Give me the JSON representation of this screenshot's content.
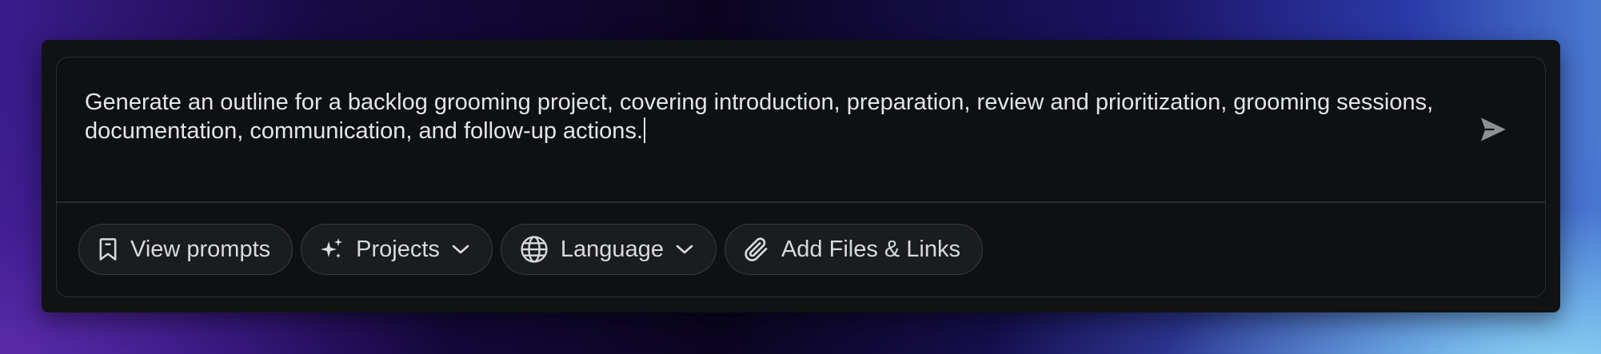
{
  "composer": {
    "prompt_text": "Generate an outline for a backlog grooming project, covering introduction, preparation, review and prioritization, grooming sessions, documentation, communication, and follow-up actions.",
    "send_icon": "send-icon"
  },
  "toolbar": {
    "view_prompts": {
      "label": "View prompts",
      "icon": "bookmark-icon"
    },
    "projects": {
      "label": "Projects",
      "icon": "sparkles-icon",
      "dropdown": true
    },
    "language": {
      "label": "Language",
      "icon": "globe-icon",
      "dropdown": true
    },
    "add_files": {
      "label": "Add Files & Links",
      "icon": "paperclip-icon"
    }
  },
  "colors": {
    "panel_bg": "#111214",
    "text": "#e4e5e8",
    "chip_bg": "#1b1c20",
    "chip_border": "#3a3c42",
    "send_icon": "#8e9096"
  }
}
